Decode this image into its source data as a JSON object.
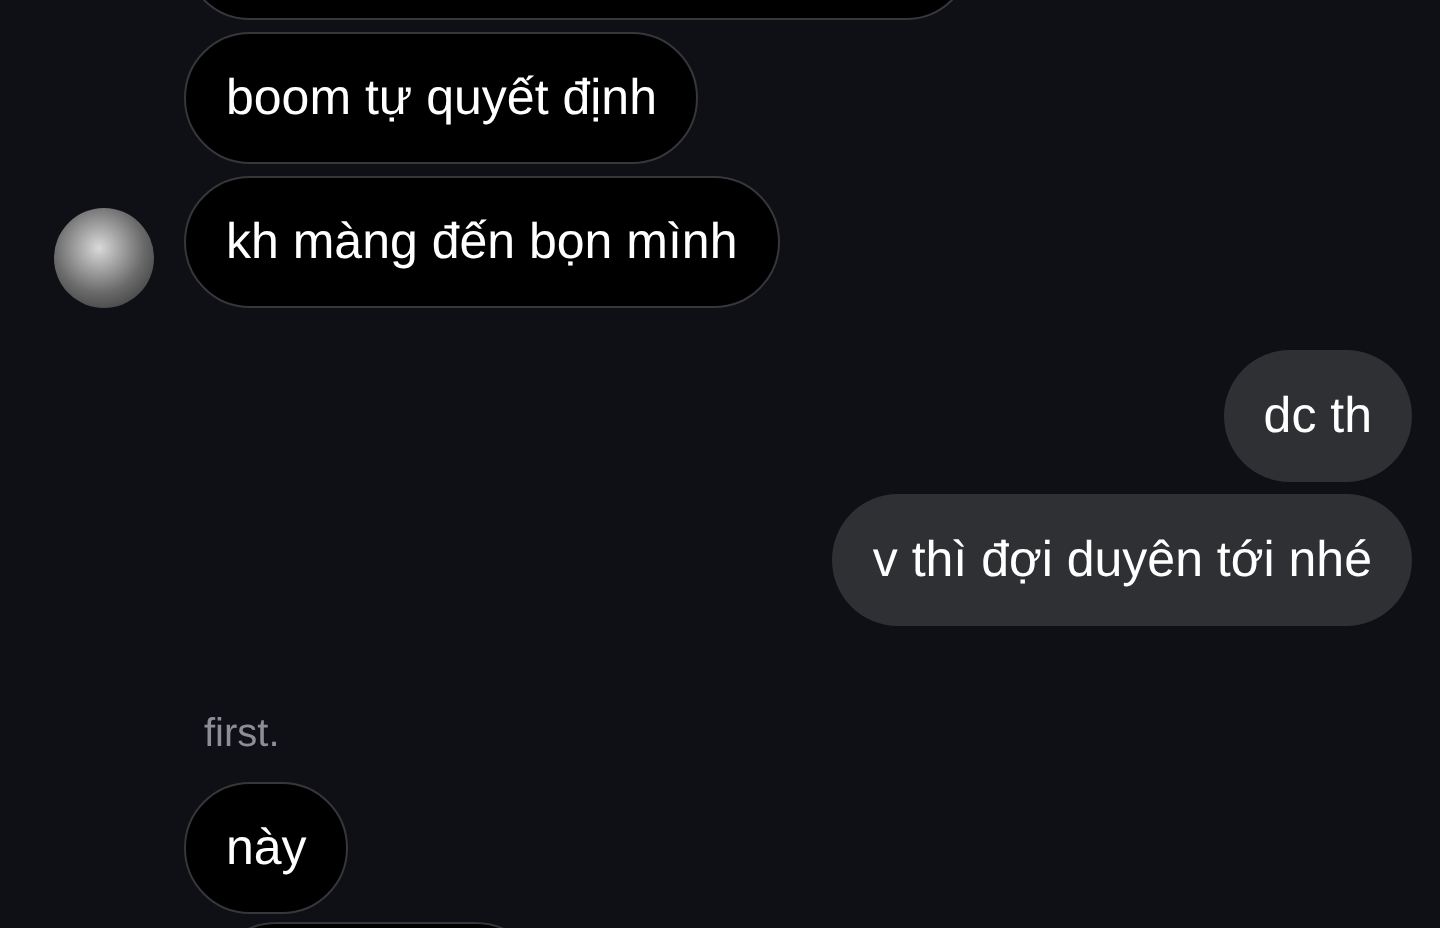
{
  "messages": [
    {
      "kind": "received",
      "text": "boom tự quyết định",
      "avatar": false
    },
    {
      "kind": "received",
      "text": "kh màng đến bọn mình",
      "avatar": true
    },
    {
      "kind": "sent",
      "text": "dc th"
    },
    {
      "kind": "sent",
      "text": "v thì đợi duyên tới nhé"
    },
    {
      "kind": "sender_name",
      "text": "first."
    },
    {
      "kind": "received",
      "text": "này",
      "avatar": false
    }
  ]
}
